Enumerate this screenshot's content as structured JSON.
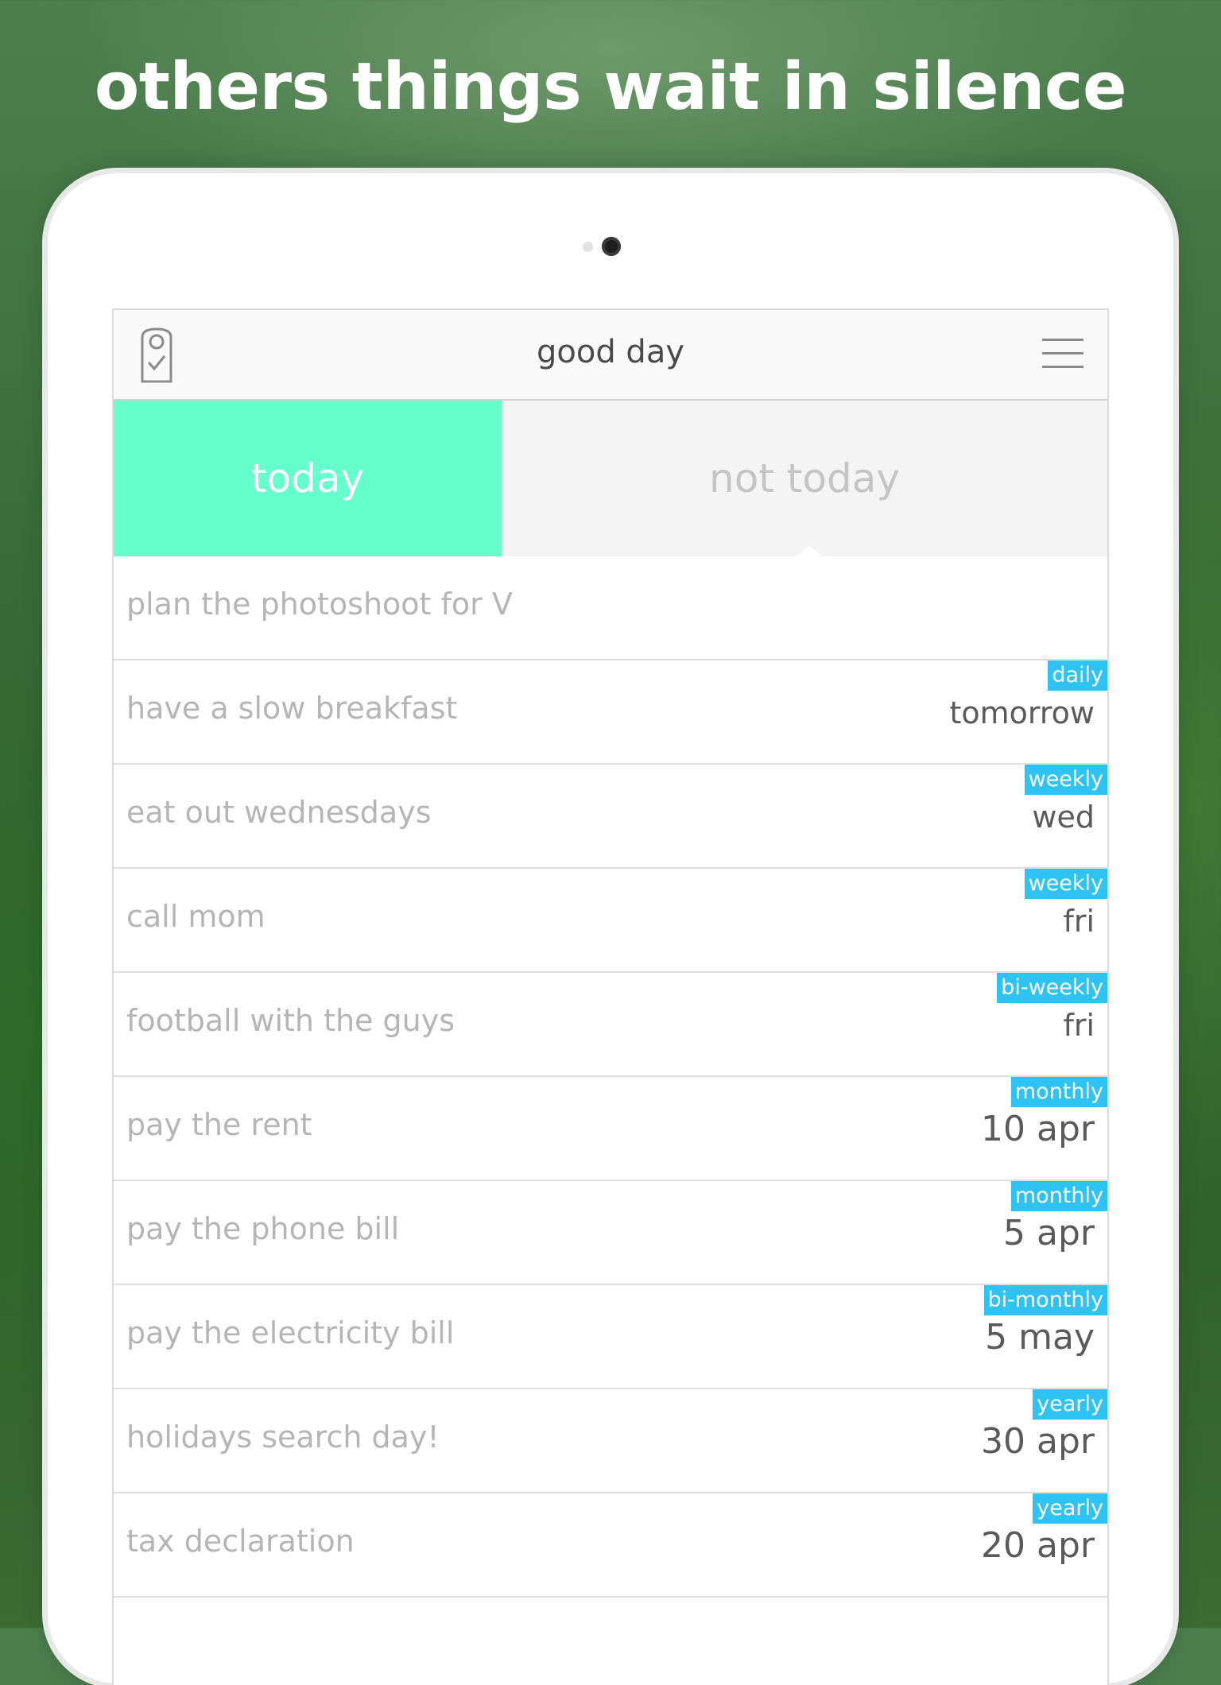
{
  "headline": "others things wait in silence",
  "header": {
    "title": "good day",
    "logo_icon": "tag-check-icon",
    "menu_icon": "hamburger-menu-icon"
  },
  "tabs": {
    "today": "today",
    "not_today": "not today",
    "active": "today"
  },
  "colors": {
    "active_tab": "#64ffcb",
    "badge": "#2ec3f3",
    "task_text": "#b5b5b5",
    "date_text": "#5a5a5a"
  },
  "tasks": [
    {
      "title": "plan the photoshoot for V",
      "frequency": "",
      "due": ""
    },
    {
      "title": "have a slow breakfast",
      "frequency": "daily",
      "due": "tomorrow"
    },
    {
      "title": "eat out wednesdays",
      "frequency": "weekly",
      "due": "wed"
    },
    {
      "title": "call mom",
      "frequency": "weekly",
      "due": "fri"
    },
    {
      "title": "football with the guys",
      "frequency": "bi-weekly",
      "due": "fri"
    },
    {
      "title": "pay the rent",
      "frequency": "monthly",
      "due": "10 apr"
    },
    {
      "title": "pay the phone bill",
      "frequency": "monthly",
      "due": "5 apr"
    },
    {
      "title": "pay the electricity bill",
      "frequency": "bi-monthly",
      "due": "5 may"
    },
    {
      "title": "holidays search day!",
      "frequency": "yearly",
      "due": "30 apr"
    },
    {
      "title": "tax declaration",
      "frequency": "yearly",
      "due": "20 apr"
    }
  ]
}
